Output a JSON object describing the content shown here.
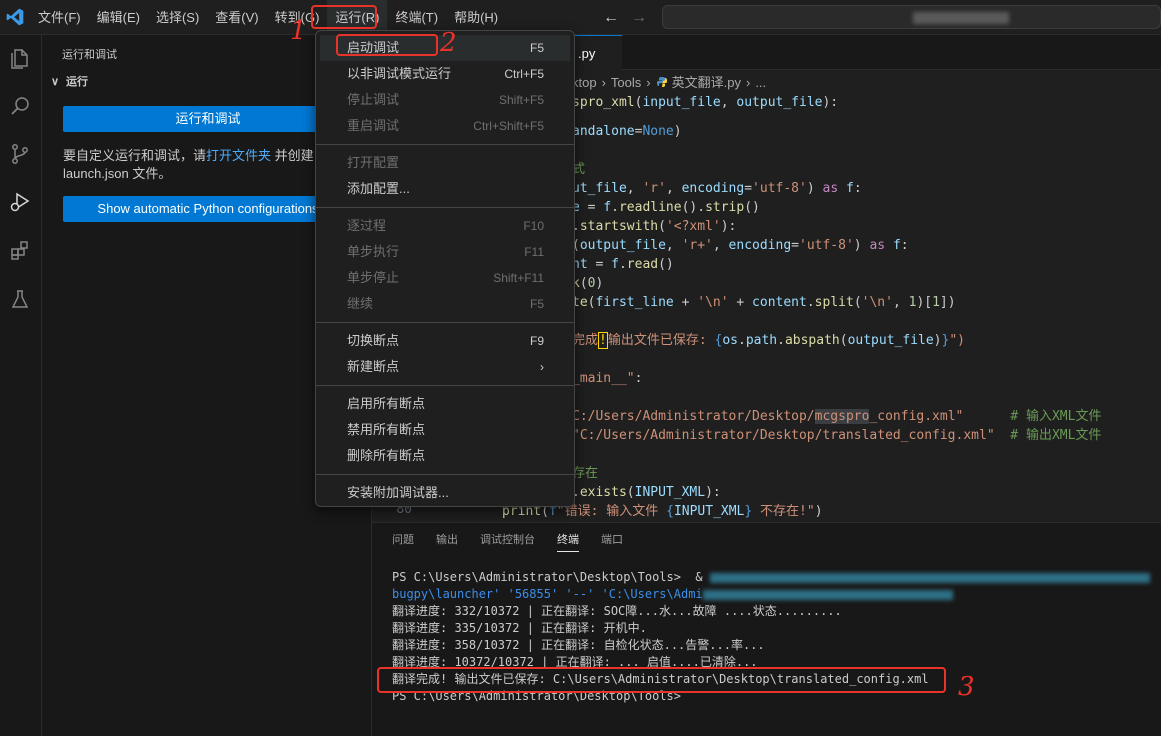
{
  "menubar": {
    "items": [
      "文件(F)",
      "编辑(E)",
      "选择(S)",
      "查看(V)",
      "转到(G)",
      "运行(R)",
      "终端(T)",
      "帮助(H)"
    ]
  },
  "sidebar": {
    "title": "运行和调试",
    "section": "运行",
    "run_button": "运行和调试",
    "text_before_link": "要自定义运行和调试，请",
    "link": "打开文件夹",
    "text_after_link": " 并创建 launch.json 文件。",
    "python_button": "Show automatic Python configurations"
  },
  "editor": {
    "tab_label": ".py",
    "breadcrumb": [
      "ktop",
      "Tools",
      "英文翻译.py",
      "..."
    ]
  },
  "run_menu": {
    "items": [
      {
        "label": "启动调试",
        "shortcut": "F5",
        "enabled": true
      },
      {
        "label": "以非调试模式运行",
        "shortcut": "Ctrl+F5",
        "enabled": true
      },
      {
        "label": "停止调试",
        "shortcut": "Shift+F5",
        "enabled": false
      },
      {
        "label": "重启调试",
        "shortcut": "Ctrl+Shift+F5",
        "enabled": false
      },
      {
        "label": "打开配置",
        "shortcut": "",
        "enabled": false
      },
      {
        "label": "添加配置...",
        "shortcut": "",
        "enabled": true
      },
      {
        "label": "逐过程",
        "shortcut": "F10",
        "enabled": false
      },
      {
        "label": "单步执行",
        "shortcut": "F11",
        "enabled": false
      },
      {
        "label": "单步停止",
        "shortcut": "Shift+F11",
        "enabled": false
      },
      {
        "label": "继续",
        "shortcut": "F5",
        "enabled": false
      },
      {
        "label": "切换断点",
        "shortcut": "F9",
        "enabled": true
      },
      {
        "label": "新建断点",
        "shortcut": "",
        "enabled": true
      },
      {
        "label": "启用所有断点",
        "shortcut": "",
        "enabled": true
      },
      {
        "label": "禁用所有断点",
        "shortcut": "",
        "enabled": true
      },
      {
        "label": "删除所有断点",
        "shortcut": "",
        "enabled": true
      },
      {
        "label": "安装附加调试器...",
        "shortcut": "",
        "enabled": true
      }
    ]
  },
  "panel": {
    "tabs": [
      "问题",
      "输出",
      "调试控制台",
      "终端",
      "端口"
    ],
    "active_tab": "终端",
    "terminal_lines": [
      "PS C:\\Users\\Administrator\\Desktop\\Tools>  & ",
      "bugpy\\launcher' '56855' '--' 'C:\\Users\\Admi",
      "翻译进度: 332/10372 | 正在翻译: SOC障...水...故障 ....状态.........",
      "翻译进度: 335/10372 | 正在翻译: 开机中.",
      "翻译进度: 358/10372 | 正在翻译: 自检化状态...告警...率...",
      "翻译进度: 10372/10372 | 正在翻译: ... 启值....已清除...",
      "翻译完成! 输出文件已保存: C:\\Users\\Administrator\\Desktop\\translated_config.xml",
      "PS C:\\Users\\Administrator\\Desktop\\Tools>"
    ]
  },
  "annotations": [
    "1",
    "2",
    "3"
  ],
  "colors": {
    "accent": "#0078d4",
    "annotation_red": "#e8332a",
    "background": "#1f1f1f",
    "sidebar": "#181818"
  },
  "icons": [
    "vscode-logo-icon",
    "explorer-icon",
    "search-icon",
    "source-control-icon",
    "run-debug-icon",
    "extensions-icon",
    "testing-icon"
  ]
}
